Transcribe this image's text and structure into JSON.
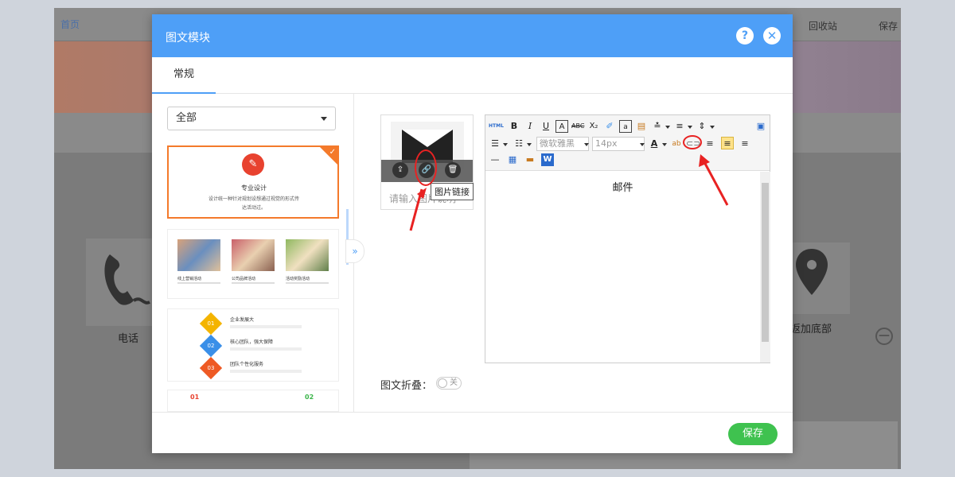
{
  "background": {
    "home_label": "首页",
    "recycle_label": "回收站",
    "save_label": "保存",
    "phone_label": "电话",
    "back_label": "返加底部",
    "minus_label": "—"
  },
  "modal": {
    "title": "图文模块",
    "help_label": "?",
    "close_label": "✕",
    "tabs": [
      {
        "label": "常规"
      }
    ],
    "category_select": {
      "value": "全部"
    },
    "templates": [
      {
        "title": "专业设计",
        "desc": "设计统一种针对规划设想通过视觉的形式传达活动过。"
      },
      {
        "captions": [
          "线上营销活动",
          "公司品牌活动",
          "活动奖励活动"
        ]
      },
      {
        "steps": [
          {
            "num": "01",
            "title": "企业发展大"
          },
          {
            "num": "02",
            "title": "核心团队，强大保障"
          },
          {
            "num": "03",
            "title": "团队个性化服务"
          }
        ]
      },
      {
        "nums": [
          "01",
          "02"
        ]
      }
    ],
    "collapse_label": "»",
    "image": {
      "placeholder": "请输入图片说明",
      "tooltip": "图片链接"
    },
    "editor": {
      "font_family": "微软雅黑",
      "font_size": "14px",
      "content": "邮件"
    },
    "fold": {
      "label": "图文折叠：",
      "toggle_text": "关"
    },
    "save_label": "保存"
  },
  "colors": {
    "header_blue": "#4e9ff7",
    "accent_orange": "#f47a2b",
    "save_green": "#3fc24f",
    "annotation_red": "#e82222"
  }
}
